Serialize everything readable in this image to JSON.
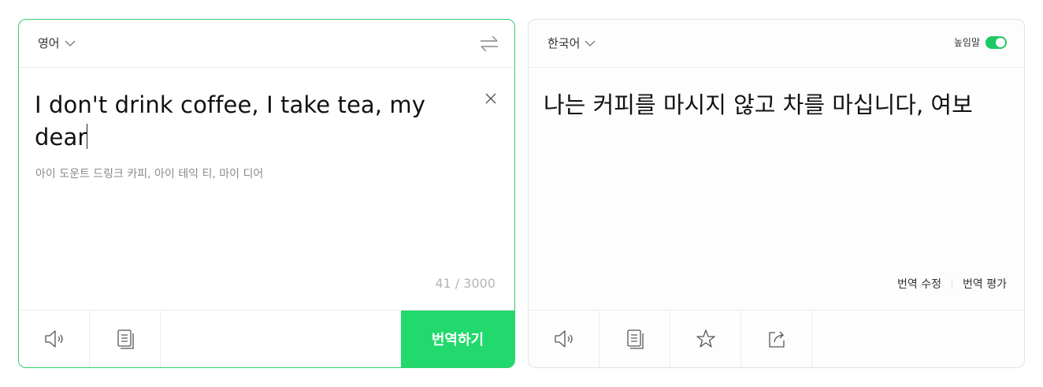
{
  "source": {
    "language": "영어",
    "text": "I don't drink coffee, I take tea, my dear",
    "pronunciation": "아이 도운트 드링크 카피, 아이 테익 티, 마이 디어",
    "char_count": "41 / 3000",
    "translate_button": "번역하기",
    "icons": [
      "speaker-icon",
      "copy-icon",
      "swap-icon",
      "clear-icon"
    ]
  },
  "target": {
    "language": "한국어",
    "honorific_label": "높임말",
    "honorific_on": true,
    "text": "나는 커피를 마시지 않고 차를 마십니다, 여보",
    "edit_label": "번역 수정",
    "rate_label": "번역 평가",
    "icons": [
      "speaker-icon",
      "copy-icon",
      "star-icon",
      "share-icon"
    ]
  },
  "colors": {
    "accent": "#21d96c",
    "source_border": "#2fd068",
    "toggle": "#1ec863"
  }
}
